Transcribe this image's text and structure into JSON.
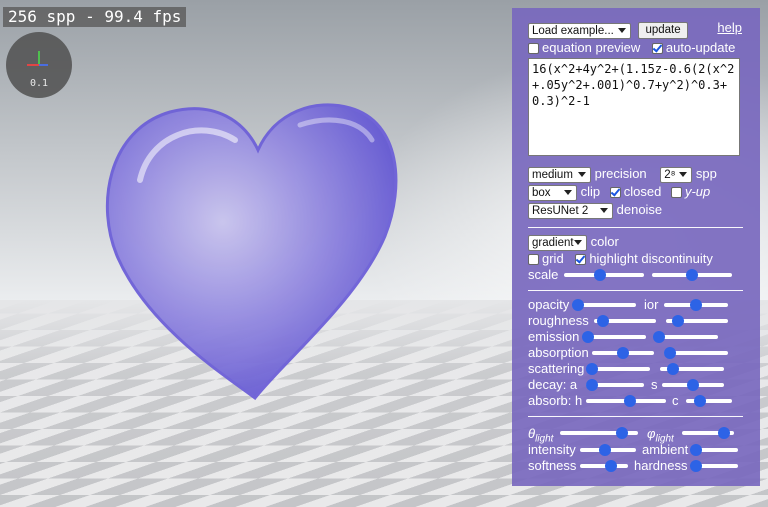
{
  "status": {
    "fps_text": "256 spp - 99.4 fps"
  },
  "gizmo": {
    "scale_text": "0.1"
  },
  "panel": {
    "load_example": "Load example...",
    "update": "update",
    "help": "help",
    "equation_preview": "equation preview",
    "equation_preview_on": false,
    "auto_update": "auto-update",
    "auto_update_on": true,
    "equation": "16(x^2+4y^2+(1.15z-0.6(2(x^2+.05y^2+.001)^0.7+y^2)^0.3+0.3)^2-1",
    "precision_value": "medium",
    "precision_label": "precision",
    "spp_value": "2⁸",
    "spp_label": "spp",
    "clip_value": "box",
    "clip_label": "clip",
    "closed_label": "closed",
    "closed_on": true,
    "yup_label": "y-up",
    "yup_on": false,
    "denoise_value": "ResUNet 2",
    "denoise_label": "denoise",
    "color_value": "gradient",
    "color_label": "color",
    "grid_label": "grid",
    "grid_on": false,
    "highlight_label": "highlight discontinuity",
    "highlight_on": true,
    "scale_label": "scale",
    "opacity_label": "opacity",
    "ior_label": "ior",
    "roughness_label": "roughness",
    "emission_label": "emission",
    "absorption_label": "absorption",
    "scattering_label": "scattering",
    "decay_label": "decay: a",
    "decay_s_label": "s",
    "absorb_label": "absorb: h",
    "absorb_c_label": "c",
    "theta_label": "θ",
    "theta_sub": "light",
    "phi_label": "φ",
    "phi_sub": "light",
    "intensity_label": "intensity",
    "ambient_label": "ambient",
    "softness_label": "softness",
    "hardness_label": "hardness"
  },
  "sliders": {
    "scale_a": 0.45,
    "scale_b": 0.5,
    "opacity": 0.0,
    "ior": 0.5,
    "roughness": 0.15,
    "roughness_b": 0.2,
    "emission": 0.0,
    "emission_b": 0.05,
    "absorption": 0.5,
    "absorption_b": 0.1,
    "scattering": 0.0,
    "scattering_b": 0.2,
    "decay_a": 0.1,
    "decay_s": 0.5,
    "absorb_h": 0.55,
    "absorb_c": 0.3,
    "theta": 0.8,
    "phi": 0.8,
    "intensity": 0.45,
    "ambient": 0.08,
    "softness": 0.65,
    "hardness": 0.05
  },
  "colors": {
    "panel": "#7868be",
    "accent": "#2d63e6",
    "heart": "#8a7ee6"
  }
}
